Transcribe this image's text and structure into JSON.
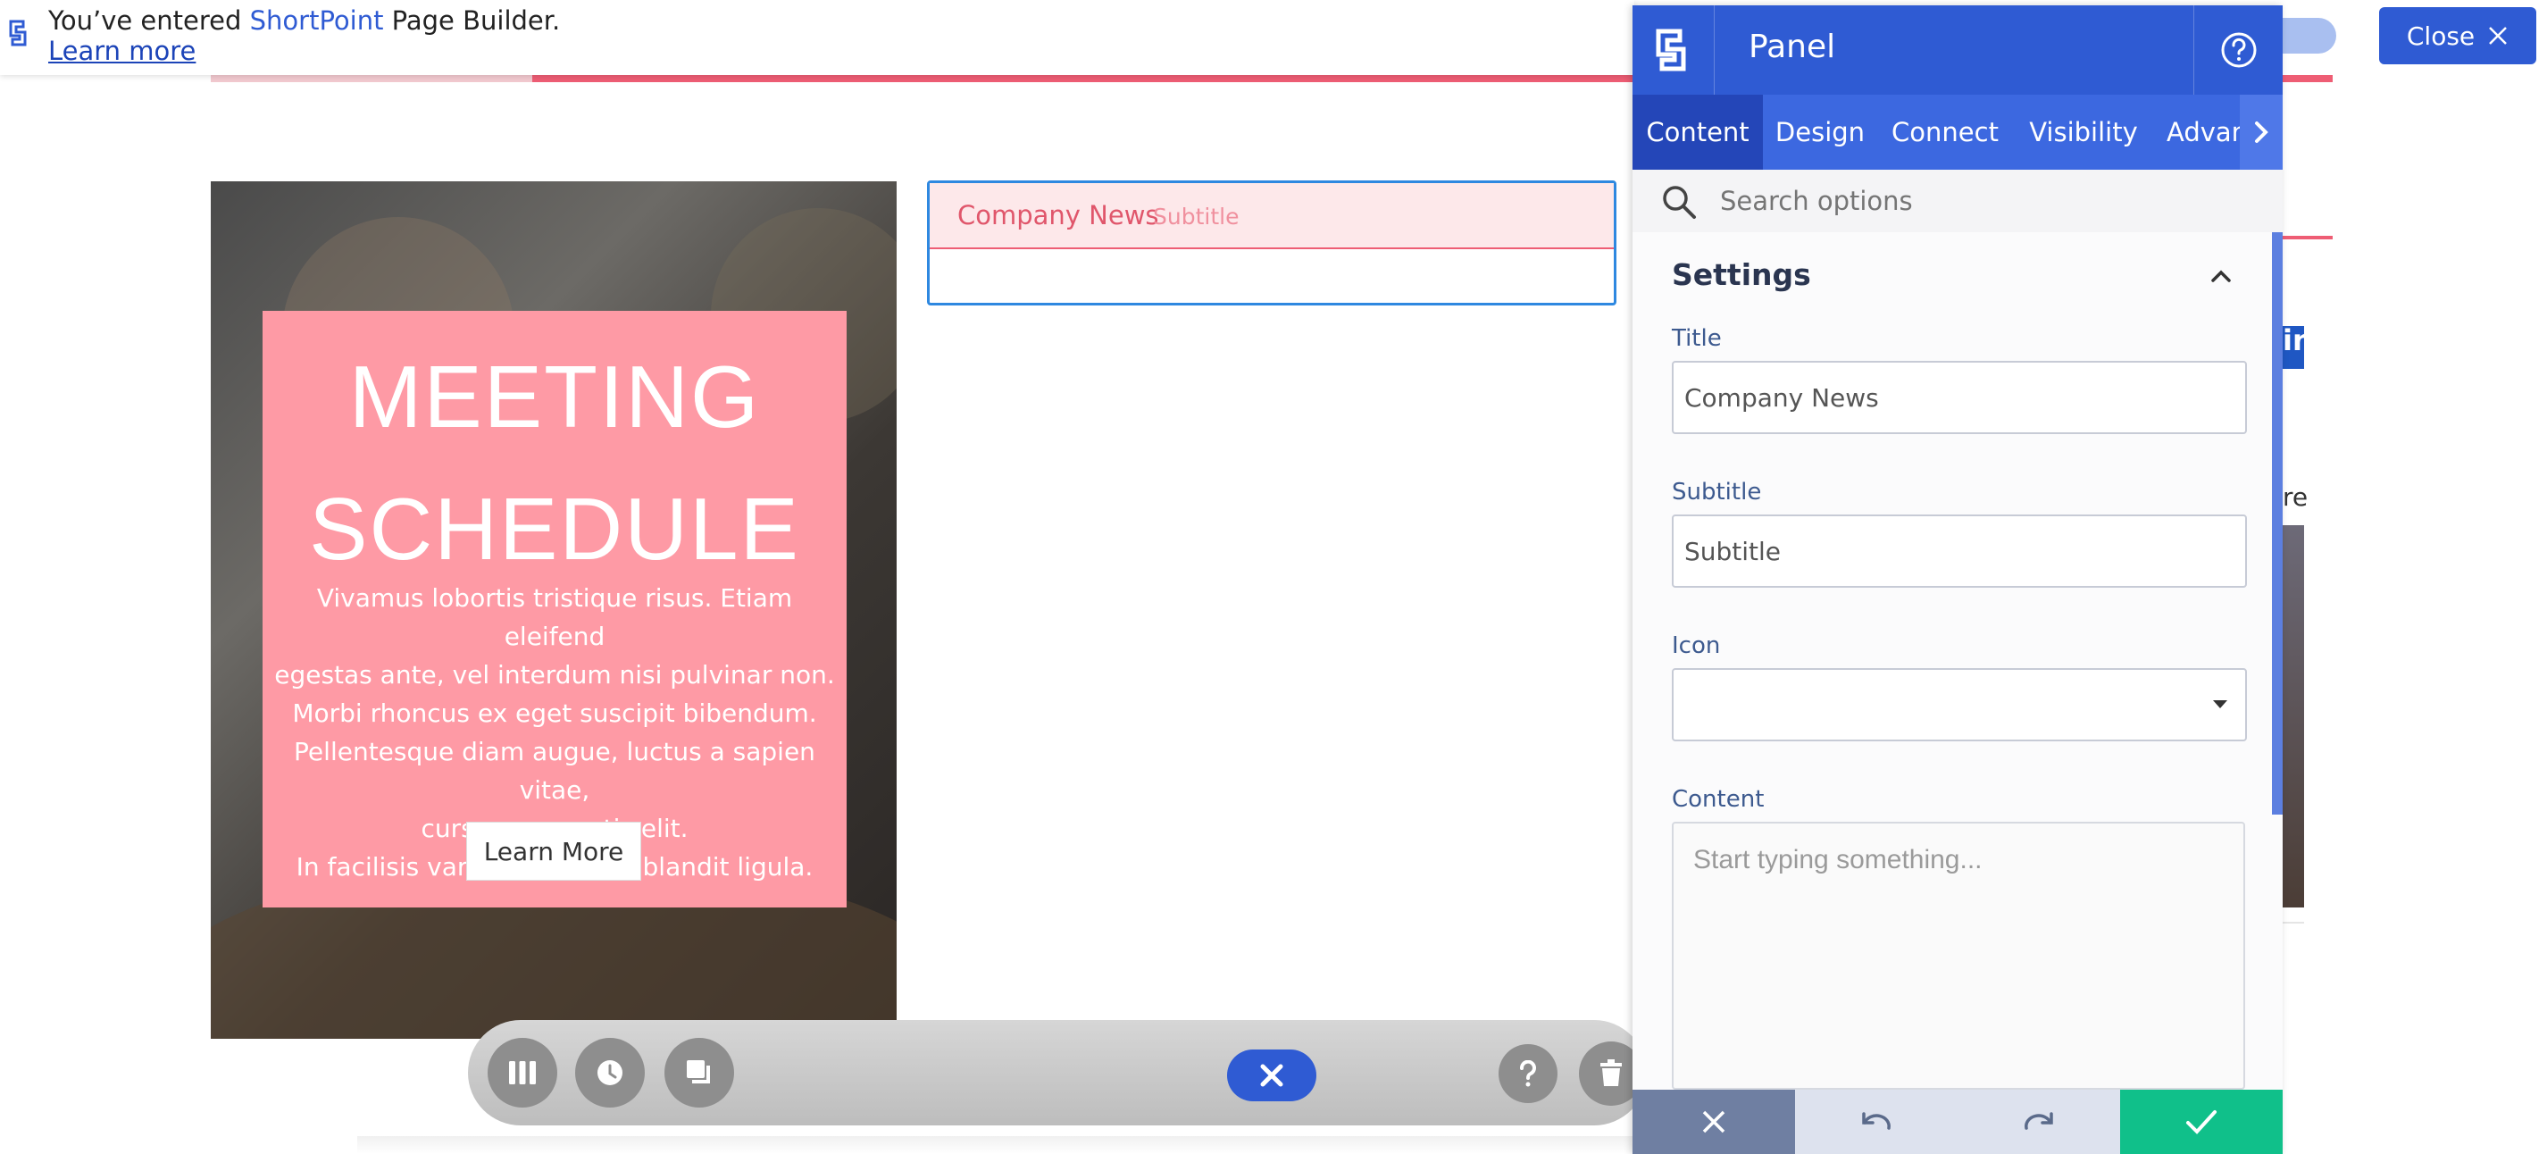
{
  "notice": {
    "prefix": "You’ve entered ",
    "brand": "ShortPoint",
    "suffix": " Page Builder.",
    "learn_more": "Learn more"
  },
  "close_button": {
    "label": "Close"
  },
  "meeting_tile": {
    "title_line1": "MEETING",
    "title_line2": "SCHEDULE",
    "desc_lines": [
      "Vivamus lobortis tristique risus. Etiam eleifend",
      "egestas ante, vel interdum nisi pulvinar non.",
      "Morbi rhoncus ex eget suscipit bibendum.",
      "Pellentesque diam augue, luctus a sapien vitae,",
      "cursus venenatis elit.",
      "In facilisis varius enim, nec blandit ligula."
    ],
    "button": "Learn More"
  },
  "news_widget": {
    "title": "Company News",
    "subtitle": "Subtitle"
  },
  "background_right": {
    "partial_text": "re",
    "linkedin_glyph": "in"
  },
  "panel": {
    "title": "Panel",
    "tabs": [
      {
        "label": "Content",
        "active": true
      },
      {
        "label": "Design",
        "active": false
      },
      {
        "label": "Connect",
        "active": false
      },
      {
        "label": "Visibility",
        "active": false
      },
      {
        "label": "Advan",
        "active": false
      }
    ],
    "search": {
      "placeholder": "Search options"
    },
    "settings": {
      "heading": "Settings",
      "title_label": "Title",
      "title_value": "Company News",
      "subtitle_label": "Subtitle",
      "subtitle_value": "Subtitle",
      "icon_label": "Icon",
      "icon_value": "",
      "content_label": "Content",
      "content_placeholder": "Start typing something..."
    }
  },
  "colors": {
    "brand_blue": "#2f5bd3",
    "tile_pink": "#fe9aa5",
    "accent_pink": "#ee5d74",
    "save_green": "#10c08a"
  }
}
